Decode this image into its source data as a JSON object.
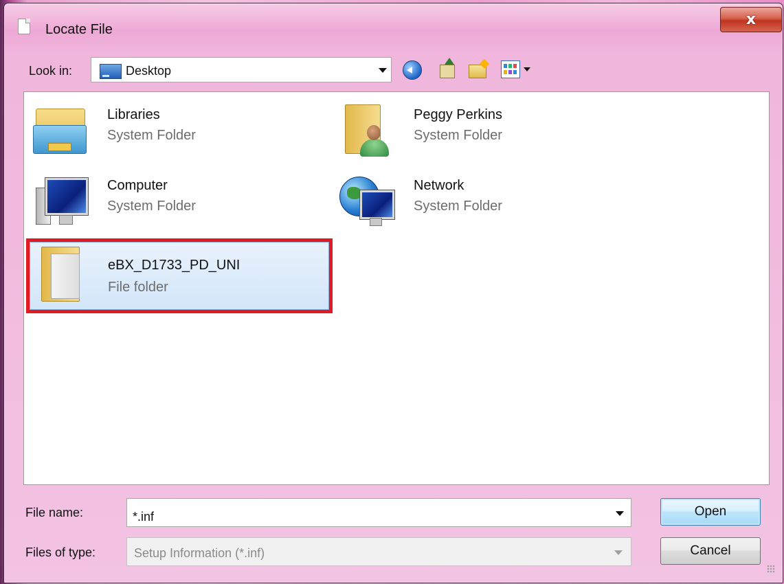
{
  "window": {
    "title": "Locate File",
    "close_glyph": "x"
  },
  "toolbar": {
    "look_in_label": "Look in:",
    "look_in_value": "Desktop",
    "icons": [
      "back-arrow-icon",
      "up-one-level-icon",
      "new-folder-icon",
      "view-menu-icon"
    ]
  },
  "items": [
    {
      "name": "Libraries",
      "kind": "System Folder",
      "icon": "libraries-icon"
    },
    {
      "name": "Peggy Perkins",
      "kind": "System Folder",
      "icon": "user-folder-icon"
    },
    {
      "name": "Computer",
      "kind": "System Folder",
      "icon": "computer-icon"
    },
    {
      "name": "Network",
      "kind": "System Folder",
      "icon": "network-icon"
    },
    {
      "name": "eBX_D1733_PD_UNI",
      "kind": "File folder",
      "icon": "folder-icon",
      "selected": true
    }
  ],
  "footer": {
    "file_name_label": "File name:",
    "file_name_value": "*.inf",
    "files_of_type_label": "Files of type:",
    "files_of_type_value": "Setup Information (*.inf)",
    "open_label": "Open",
    "cancel_label": "Cancel"
  },
  "colors": {
    "highlight_border": "#e01b24",
    "selection": "#d2e6f9",
    "close_button": "#c0341f"
  }
}
